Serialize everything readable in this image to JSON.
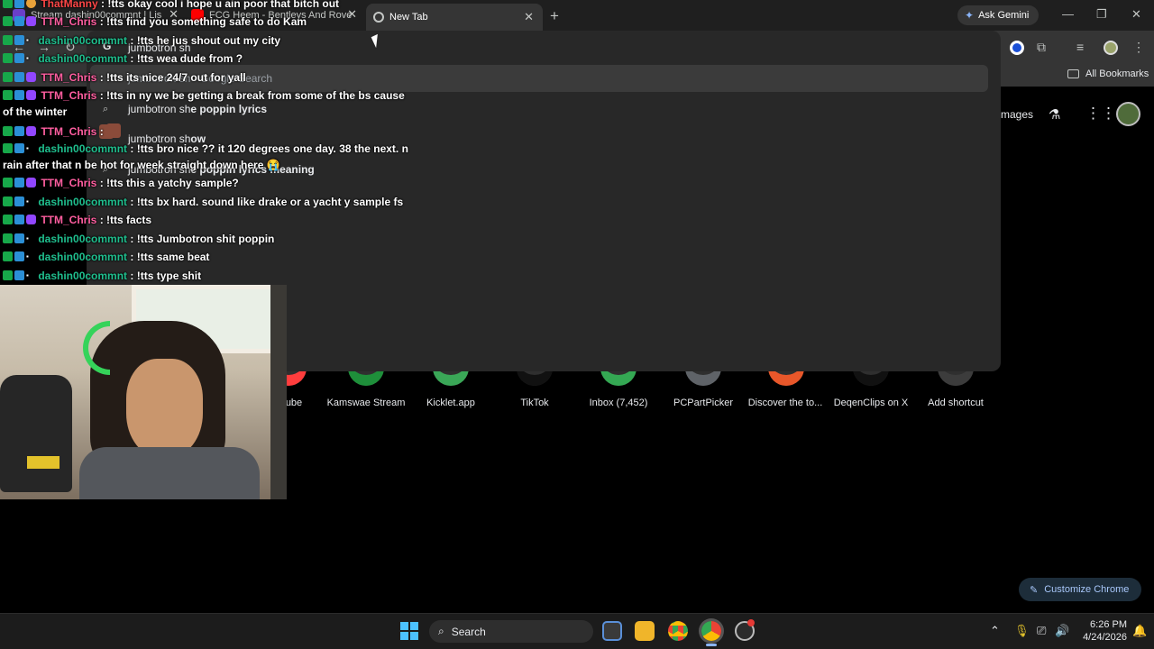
{
  "tabs": [
    {
      "title": "Stream dashin00commnt | Lis",
      "active": false
    },
    {
      "title": "FCG Heem - Bentleys And Rove",
      "active": false
    },
    {
      "title": "New Tab",
      "active": true
    }
  ],
  "ask_gemini": "Ask Gemini",
  "omnibox": {
    "typed_text": "jumbotron sh",
    "suggestions": [
      {
        "plain": "jumbotron sh",
        "bold": " - Google Search",
        "icon": "search-icon",
        "faded": true
      },
      {
        "plain": "jumbotron sh",
        "bold": "e poppin lyrics",
        "icon": "search-icon"
      },
      {
        "plain": "jumbotron sh",
        "bold": "ow",
        "icon": "thumbnail-icon"
      },
      {
        "plain": "jumbotron sh",
        "bold": "e poppin lyrics meaning",
        "icon": "search-icon"
      }
    ]
  },
  "bookmarks": {
    "all_label": "All Bookmarks"
  },
  "ntp": {
    "images_link": "mages",
    "shortcuts": [
      {
        "label": "ube",
        "color": "#ff3d3d"
      },
      {
        "label": "Kamswae Stream",
        "color": "#1e8f3a"
      },
      {
        "label": "Kicklet.app",
        "color": "#3aa757"
      },
      {
        "label": "TikTok",
        "color": "#111111"
      },
      {
        "label": "Inbox (7,452)",
        "color": "#34a853"
      },
      {
        "label": "PCPartPicker",
        "color": "#5f6368"
      },
      {
        "label": "Discover the to...",
        "color": "#e8572a"
      },
      {
        "label": "DeqenClips on X",
        "color": "#111111"
      },
      {
        "label": "Add shortcut",
        "color": "#3c3c3c"
      }
    ],
    "customize_label": "Customize Chrome"
  },
  "chat": [
    {
      "user": "ThatManny",
      "user_color": "red",
      "message": ": !tts okay cool i hope u ain poor that bitch out",
      "badges": "mod-vip-sm"
    },
    {
      "user": "TTM_Chris",
      "user_color": "pink",
      "message": ": !tts find you something safe to do Kam",
      "badges": "mod-vip-sub"
    },
    {
      "user": "dashin00commnt",
      "user_color": "green",
      "message": ": !tts he jus shout out my city",
      "badges": "mod-vip-sm"
    },
    {
      "user": "dashin00commnt",
      "user_color": "green",
      "message": ": !tts wea dude from ?",
      "badges": "mod-vip-sm"
    },
    {
      "user": "TTM_Chris",
      "user_color": "pink",
      "message": ": !tts its nice 24/7 out for yall",
      "badges": "mod-vip-sub"
    },
    {
      "user": "TTM_Chris",
      "user_color": "pink",
      "message": ": !tts in ny we be getting a break from some of the bs cause",
      "badges": "mod-vip-sub"
    },
    {
      "user": "",
      "user_color": "",
      "message": "of the winter",
      "badges": ""
    },
    {
      "user": "TTM_Chris",
      "user_color": "pink",
      "message": ":",
      "badges": "mod-vip-sub",
      "emote": true
    },
    {
      "user": "dashin00commnt",
      "user_color": "green",
      "message": ": !tts bro nice ?? it 120 degrees one day. 38 the next. n",
      "badges": "mod-vip-sm"
    },
    {
      "user": "",
      "user_color": "",
      "message": "rain after that n be hot for week straight down here 😭",
      "badges": ""
    },
    {
      "user": "TTM_Chris",
      "user_color": "pink",
      "message": ": !tts this a yatchy sample?",
      "badges": "mod-vip-sub"
    },
    {
      "user": "dashin00commnt",
      "user_color": "green",
      "message": ": !tts bx hard. sound like drake or a yacht y sample fs",
      "badges": "mod-vip-sm"
    },
    {
      "user": "TTM_Chris",
      "user_color": "pink",
      "message": ": !tts facts",
      "badges": "mod-vip-sub"
    },
    {
      "user": "dashin00commnt",
      "user_color": "green",
      "message": ": !tts Jumbotron shit poppin",
      "badges": "mod-vip-sm"
    },
    {
      "user": "dashin00commnt",
      "user_color": "green",
      "message": ": !tts same beat",
      "badges": "mod-vip-sm"
    },
    {
      "user": "dashin00commnt",
      "user_color": "green",
      "message": ": !tts type shit",
      "badges": "mod-vip-sm"
    }
  ],
  "taskbar": {
    "search_label": "Search",
    "time": "6:26 PM",
    "date": "4/24/2026"
  }
}
